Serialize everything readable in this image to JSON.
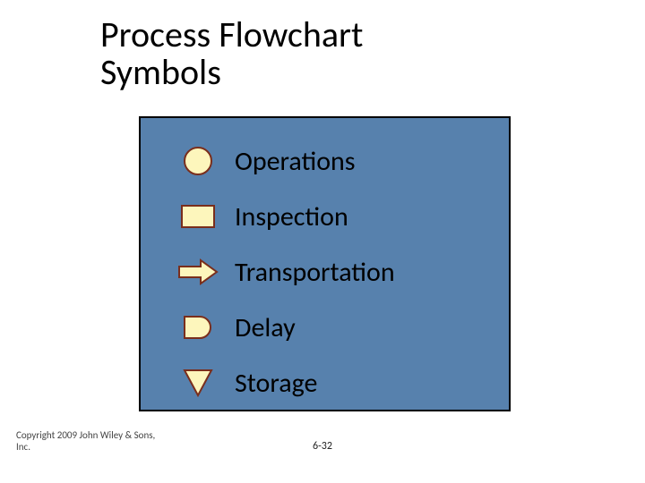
{
  "title_line1": "Process Flowchart",
  "title_line2": "Symbols",
  "rows": [
    {
      "icon": "operations-icon",
      "label": "Operations"
    },
    {
      "icon": "inspection-icon",
      "label": "Inspection"
    },
    {
      "icon": "transportation-icon",
      "label": "Transportation"
    },
    {
      "icon": "delay-icon",
      "label": "Delay"
    },
    {
      "icon": "storage-icon",
      "label": "Storage"
    }
  ],
  "copyright": "Copyright 2009 John Wiley & Sons, Inc.",
  "page_number": "6-32",
  "colors": {
    "panel_bg": "#5781ad",
    "shape_fill": "#fdf6bc",
    "shape_stroke": "#7a2e1c"
  }
}
